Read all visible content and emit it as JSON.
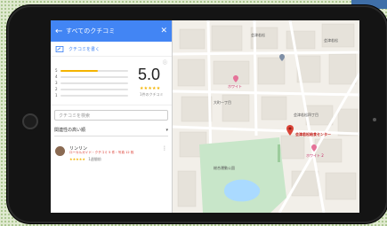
{
  "panel": {
    "header_title": "すべてのクチコミ",
    "back_icon": "←",
    "close_icon": "✕",
    "write_review": "クチコミを書く"
  },
  "rating": {
    "score": "5.0",
    "stars": "★★★★★",
    "count_text": "1件のクチコミ",
    "distribution": [
      {
        "label": "5",
        "fraction": 0.55
      },
      {
        "label": "4",
        "fraction": 0
      },
      {
        "label": "3",
        "fraction": 0
      },
      {
        "label": "2",
        "fraction": 0
      },
      {
        "label": "1",
        "fraction": 0
      }
    ]
  },
  "search": {
    "placeholder": "クチコミを検索"
  },
  "sort": {
    "label": "関連性の高い順"
  },
  "reviews": [
    {
      "author": "リンリン",
      "meta": "ローカルガイド・クチコミ 5 件・写真 12 枚",
      "stars": "★★★★★",
      "date": "1週間前"
    }
  ],
  "map": {
    "labels": {
      "office": "会津若松給食センター",
      "school": "会津若松",
      "pink_place": "ホワイト",
      "pink_place2": "ホワイト 2",
      "park": "総合運動公園",
      "town1": "大町一丁目",
      "town2": "会津若松四丁目",
      "top_right": "会津若松"
    }
  },
  "colors": {
    "header": "#4285f4",
    "star": "#f4b400",
    "park": "#c8e6c9",
    "water": "#aadaff",
    "pin": "#db4437"
  }
}
